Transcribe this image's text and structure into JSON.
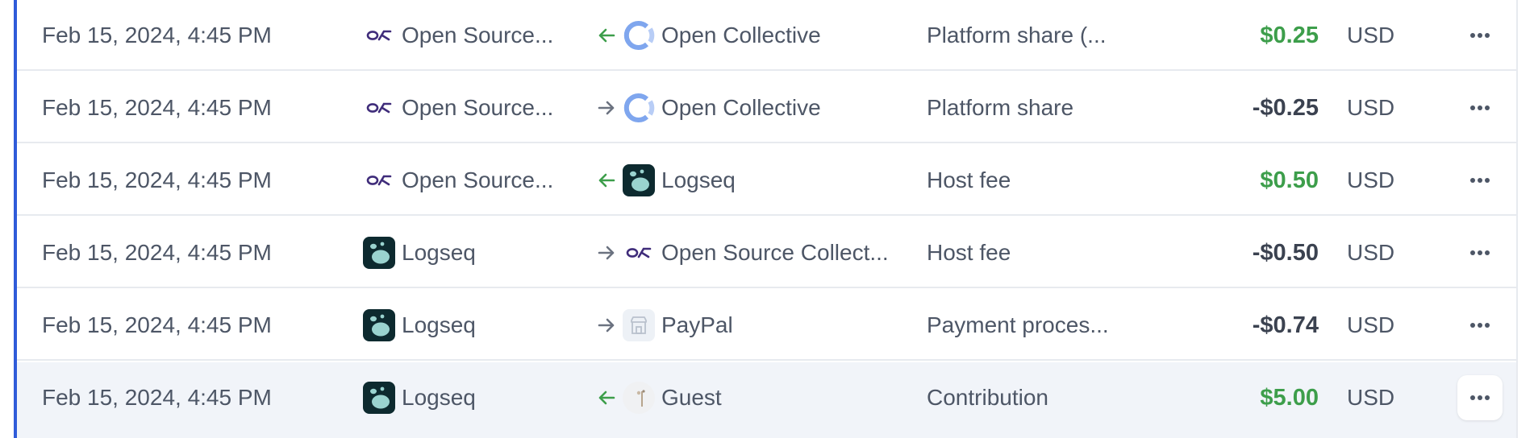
{
  "rows": [
    {
      "date": "Feb 15, 2024, 4:45 PM",
      "from": {
        "name": "Open Source...",
        "avatar": "osc-logo-icon"
      },
      "direction": "incoming",
      "to": {
        "name": "Open Collective",
        "avatar": "open-collective-logo-icon"
      },
      "description": "Platform share (...",
      "amount": "$0.25",
      "amount_type": "positive",
      "currency": "USD"
    },
    {
      "date": "Feb 15, 2024, 4:45 PM",
      "from": {
        "name": "Open Source...",
        "avatar": "osc-logo-icon"
      },
      "direction": "outgoing",
      "to": {
        "name": "Open Collective",
        "avatar": "open-collective-logo-icon"
      },
      "description": "Platform share",
      "amount": "-$0.25",
      "amount_type": "negative",
      "currency": "USD"
    },
    {
      "date": "Feb 15, 2024, 4:45 PM",
      "from": {
        "name": "Open Source...",
        "avatar": "osc-logo-icon"
      },
      "direction": "incoming",
      "to": {
        "name": "Logseq",
        "avatar": "logseq-logo-icon"
      },
      "description": "Host fee",
      "amount": "$0.50",
      "amount_type": "positive",
      "currency": "USD"
    },
    {
      "date": "Feb 15, 2024, 4:45 PM",
      "from": {
        "name": "Logseq",
        "avatar": "logseq-logo-icon"
      },
      "direction": "outgoing",
      "to": {
        "name": "Open Source Collect...",
        "avatar": "osc-logo-icon"
      },
      "description": "Host fee",
      "amount": "-$0.50",
      "amount_type": "negative",
      "currency": "USD"
    },
    {
      "date": "Feb 15, 2024, 4:45 PM",
      "from": {
        "name": "Logseq",
        "avatar": "logseq-logo-icon"
      },
      "direction": "outgoing",
      "to": {
        "name": "PayPal",
        "avatar": "paypal-building-icon"
      },
      "description": "Payment proces...",
      "amount": "-$0.74",
      "amount_type": "negative",
      "currency": "USD"
    },
    {
      "date": "Feb 15, 2024, 4:45 PM",
      "from": {
        "name": "Logseq",
        "avatar": "logseq-logo-icon"
      },
      "direction": "incoming",
      "to": {
        "name": "Guest",
        "avatar": "guest-avatar-icon"
      },
      "description": "Contribution",
      "amount": "$5.00",
      "amount_type": "positive",
      "currency": "USD"
    }
  ],
  "icons": {
    "incoming_arrow": "arrow-left-icon",
    "outgoing_arrow": "arrow-right-icon",
    "more": "more-horizontal-icon"
  },
  "colors": {
    "positive": "#3d9e4b",
    "negative": "#3b4250",
    "incoming_arrow": "#3d9e4b",
    "outgoing_arrow": "#6b7280",
    "accent": "#2f5bd9",
    "selected_row": "#f1f4f9",
    "osc_brand": "#3f2c7a",
    "open_collective_brand": "#7fa6ee"
  },
  "selected_row_index": 5
}
